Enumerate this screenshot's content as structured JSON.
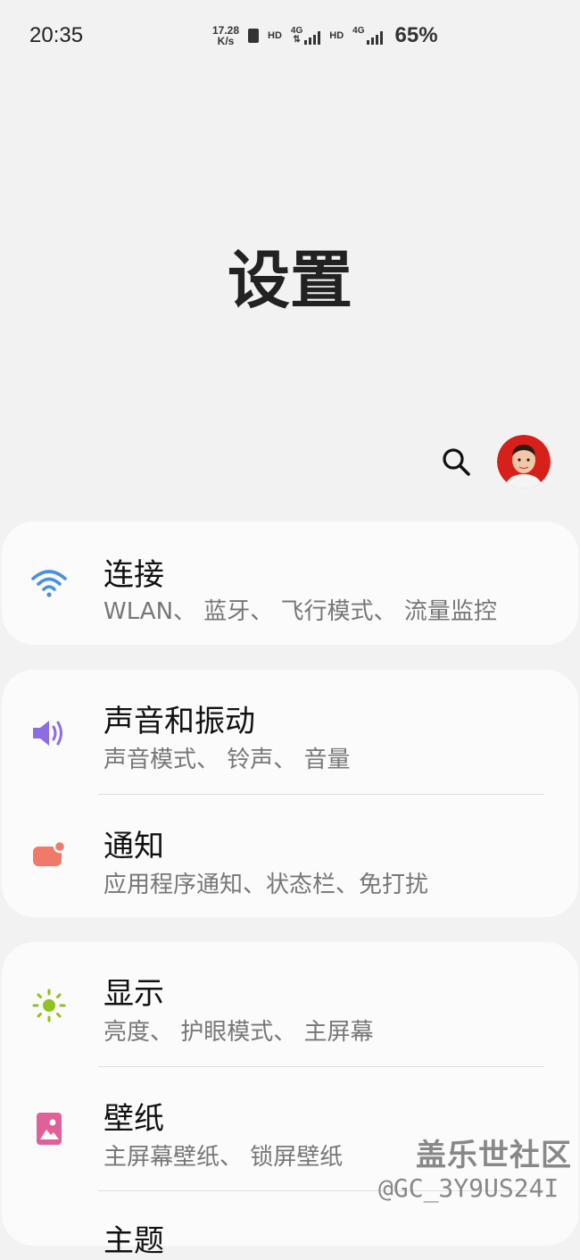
{
  "status_bar": {
    "time": "20:35",
    "speed_value": "17.28",
    "speed_unit": "K/s",
    "hd1": "HD",
    "net1": "4G",
    "hd2": "HD",
    "net2": "4G",
    "battery": "65%"
  },
  "header": {
    "title": "设置"
  },
  "sections": {
    "connection": {
      "title": "连接",
      "subtitle": "WLAN、 蓝牙、 飞行模式、 流量监控",
      "icon": "wifi-icon",
      "color": "#4a90e2"
    },
    "sound": {
      "title": "声音和振动",
      "subtitle": "声音模式、 铃声、 音量",
      "icon": "speaker-icon",
      "color": "#8e6de0"
    },
    "notifications": {
      "title": "通知",
      "subtitle": "应用程序通知、状态栏、免打扰",
      "icon": "notification-icon",
      "color": "#f07a6a"
    },
    "display": {
      "title": "显示",
      "subtitle": "亮度、 护眼模式、 主屏幕",
      "icon": "sun-icon",
      "color": "#8dc21f"
    },
    "wallpaper": {
      "title": "壁纸",
      "subtitle": "主屏幕壁纸、 锁屏壁纸",
      "icon": "picture-icon",
      "color": "#e0609a"
    },
    "themes": {
      "title": "主题"
    }
  },
  "watermark": {
    "title": "盖乐世社区",
    "handle": "@GC_3Y9US24I"
  }
}
